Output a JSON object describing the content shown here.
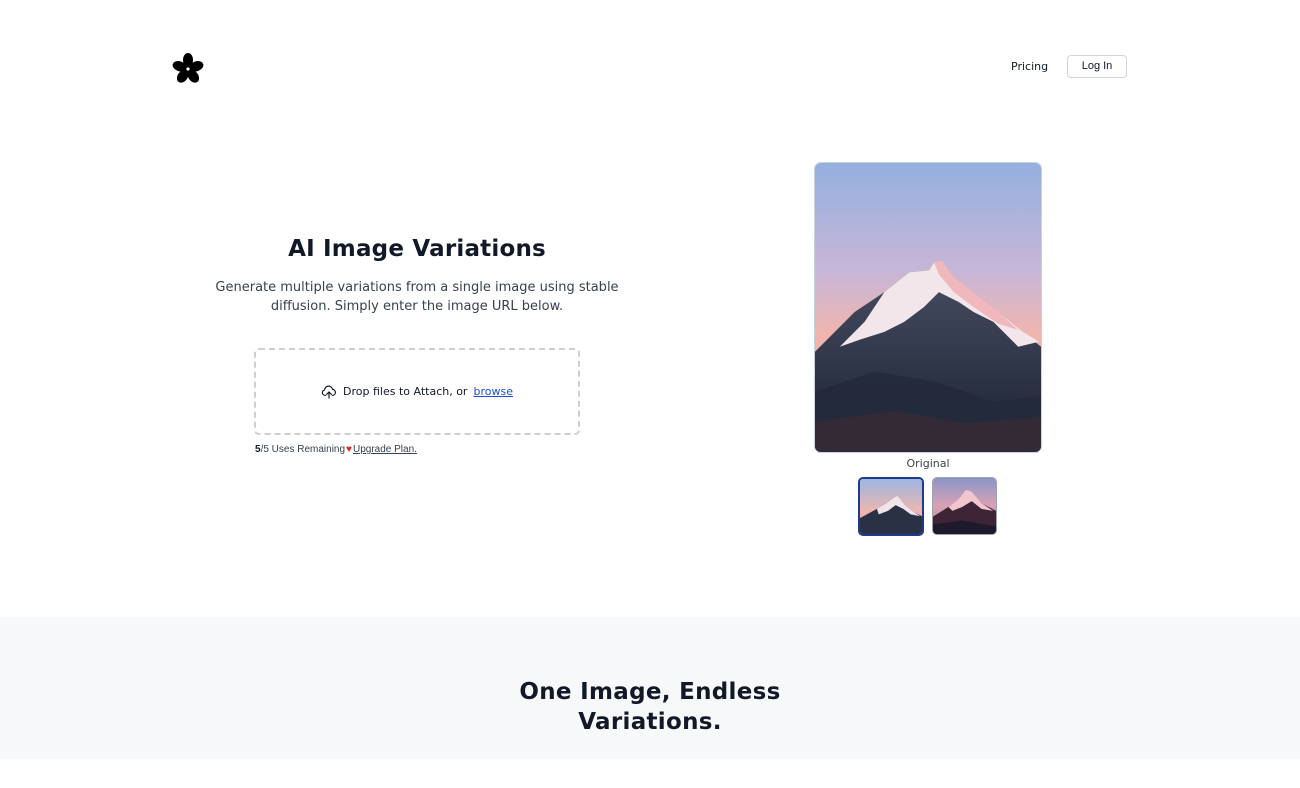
{
  "header": {
    "logo_icon": "flower-logo-icon",
    "nav_pricing": "Pricing",
    "nav_login": "Log In"
  },
  "hero": {
    "title": "AI Image Variations",
    "subtitle_line1": "Generate multiple variations from a single image using stable",
    "subtitle_line2": "diffusion. Simply enter the image URL below."
  },
  "dropzone": {
    "icon": "cloud-upload-icon",
    "text": "Drop files to Attach, or",
    "browse_label": "browse"
  },
  "usage": {
    "used": "5",
    "total_text": "/5 Uses Remaining",
    "heart_icon": "heart-icon",
    "upgrade_label": "Upgrade Plan."
  },
  "preview": {
    "caption": "Original",
    "thumbnails": [
      {
        "label": "original-thumbnail",
        "selected": true
      },
      {
        "label": "variation-thumbnail",
        "selected": false
      }
    ]
  },
  "lower": {
    "title_line1": "One Image, Endless",
    "title_line2": "Variations."
  },
  "colors": {
    "accent_link": "#1d4ed8",
    "selected_border": "#1e3a8a",
    "section_bg": "#f7f8fa",
    "heart": "#dc2626"
  }
}
